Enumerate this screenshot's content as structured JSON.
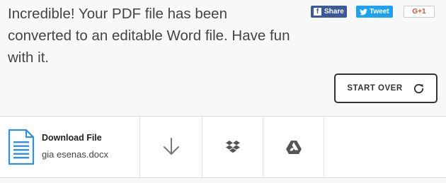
{
  "header": {
    "message": "Incredible! Your PDF file has been converted to an editable Word file. Have fun with it."
  },
  "social": {
    "facebook_label": "Share",
    "facebook_icon": "facebook-icon",
    "twitter_label": "Tweet",
    "twitter_icon": "twitter-bird-icon",
    "googleplus_label": "G+1"
  },
  "start_over": {
    "label": "START OVER",
    "icon": "refresh-icon"
  },
  "download": {
    "title": "Download File",
    "filename": "gia esenas.docx",
    "file_icon": "word-document-icon"
  },
  "actions": [
    {
      "name": "download-arrow-icon"
    },
    {
      "name": "dropbox-icon"
    },
    {
      "name": "google-drive-icon"
    }
  ],
  "colors": {
    "facebook": "#3b5998",
    "twitter": "#1da1f2",
    "googleplus": "#dd4b39",
    "doc_icon": "#2f8ee5"
  }
}
